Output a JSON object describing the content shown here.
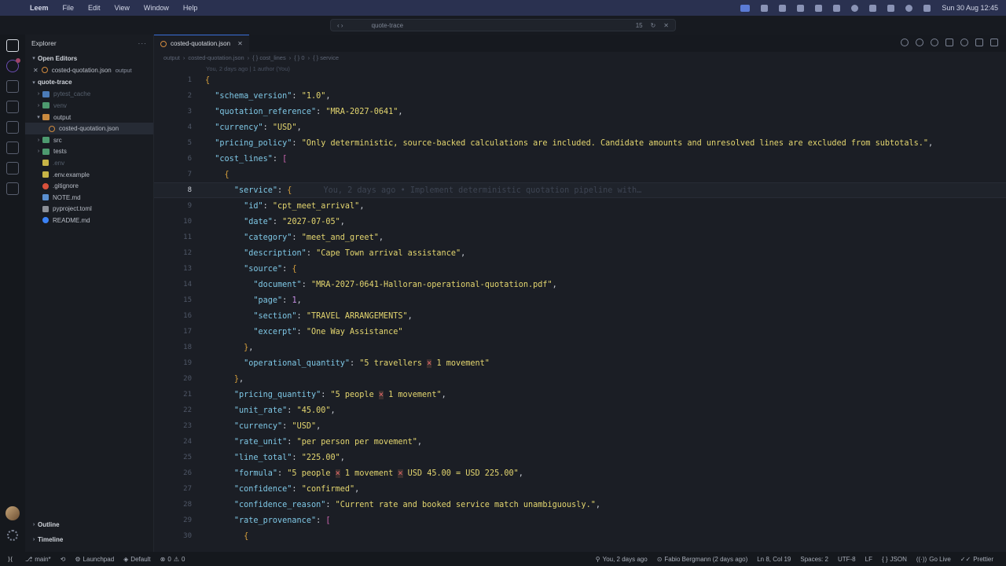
{
  "menubar": {
    "app_name": "Leem",
    "menus": [
      "File",
      "Edit",
      "View",
      "Window",
      "Help"
    ],
    "clock": "Sun 30 Aug  12:45"
  },
  "titlebar": {
    "search_text": "quote-trace",
    "badge_count": "15"
  },
  "sidebar": {
    "title": "Explorer",
    "open_editors_label": "Open Editors",
    "open_editor_file": "costed-quotation.json",
    "open_editor_tag": "output",
    "project_label": "quote-trace",
    "items": [
      {
        "label": "pytest_cache",
        "kind": "folder",
        "dim": true
      },
      {
        "label": "venv",
        "kind": "folder-green",
        "dim": true
      },
      {
        "label": "output",
        "kind": "folder-orange",
        "dim": false
      },
      {
        "label": "costed-quotation.json",
        "kind": "json",
        "dim": false
      },
      {
        "label": "src",
        "kind": "folder-green",
        "dim": false
      },
      {
        "label": "tests",
        "kind": "folder-green",
        "dim": false
      },
      {
        "label": ".env",
        "kind": "env",
        "dim": true
      },
      {
        "label": ".env.example",
        "kind": "env",
        "dim": false
      },
      {
        "label": ".gitignore",
        "kind": "git",
        "dim": false
      },
      {
        "label": "NOTE.md",
        "kind": "md",
        "dim": false
      },
      {
        "label": "pyproject.toml",
        "kind": "toml",
        "dim": false
      },
      {
        "label": "README.md",
        "kind": "info",
        "dim": false
      }
    ],
    "outline_label": "Outline",
    "timeline_label": "Timeline"
  },
  "editor": {
    "tab_label": "costed-quotation.json",
    "breadcrumb": [
      "output",
      "costed-quotation.json",
      "{ } cost_lines",
      "{ } 0",
      "{ } service"
    ],
    "blame_header": "You, 2 days ago | 1 author (You)",
    "current_line_ghost": "You, 2 days ago • Implement deterministic quotation pipeline with…",
    "lines": [
      "{",
      "  \"schema_version\": \"1.0\",",
      "  \"quotation_reference\": \"MRA-2027-0641\",",
      "  \"currency\": \"USD\",",
      "  \"pricing_policy\": \"Only deterministic, source-backed calculations are included. Candidate amounts and unresolved lines are excluded from subtotals.\",",
      "  \"cost_lines\": [",
      "    {",
      "      \"service\": {",
      "        \"id\": \"cpt_meet_arrival\",",
      "        \"date\": \"2027-07-05\",",
      "        \"category\": \"meet_and_greet\",",
      "        \"description\": \"Cape Town arrival assistance\",",
      "        \"source\": {",
      "          \"document\": \"MRA-2027-0641-Halloran-operational-quotation.pdf\",",
      "          \"page\": 1,",
      "          \"section\": \"TRAVEL ARRANGEMENTS\",",
      "          \"excerpt\": \"One Way Assistance\"",
      "        },",
      "        \"operational_quantity\": \"5 travellers × 1 movement\"",
      "      },",
      "      \"pricing_quantity\": \"5 people × 1 movement\",",
      "      \"unit_rate\": \"45.00\",",
      "      \"currency\": \"USD\",",
      "      \"rate_unit\": \"per person per movement\",",
      "      \"line_total\": \"225.00\",",
      "      \"formula\": \"5 people × 1 movement × USD 45.00 = USD 225.00\",",
      "      \"confidence\": \"confirmed\",",
      "      \"confidence_reason\": \"Current rate and booked service match unambiguously.\",",
      "      \"rate_provenance\": [",
      "        {"
    ],
    "current_line": 8
  },
  "statusbar": {
    "branch": "main*",
    "launchpad": "Launchpad",
    "profile": "Default",
    "errors": "0",
    "warnings": "0",
    "blame": "You, 2 days ago",
    "author": "Fabio Bergmann (2 days ago)",
    "cursor": "Ln 8, Col 19",
    "spaces": "Spaces: 2",
    "encoding": "UTF-8",
    "eol": "LF",
    "language": "JSON",
    "golive": "Go Live",
    "prettier": "Prettier"
  }
}
